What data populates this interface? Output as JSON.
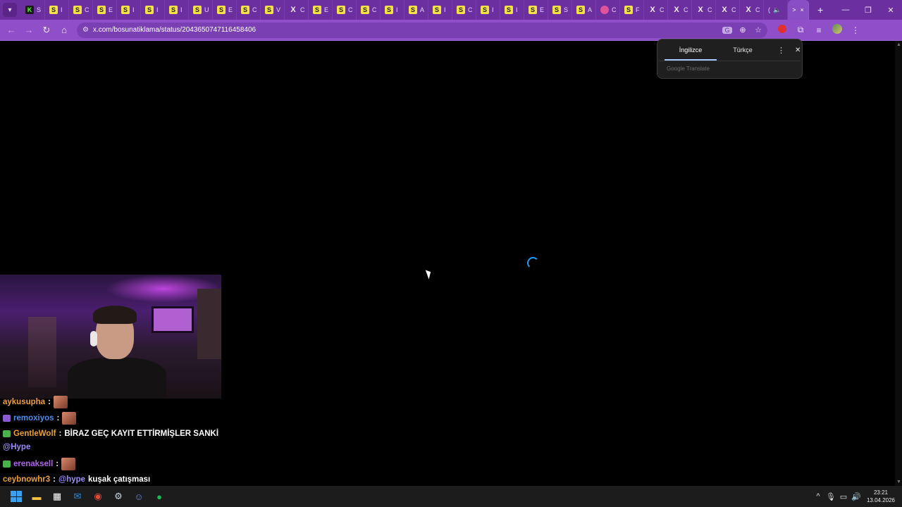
{
  "browser": {
    "tabs": [
      {
        "icon": "kick-icon",
        "glyph": "K",
        "letter": "S"
      },
      {
        "icon": "s-site-icon",
        "glyph": "S",
        "letter": "I"
      },
      {
        "icon": "s-site-icon",
        "glyph": "S",
        "letter": "C"
      },
      {
        "icon": "s-site-icon",
        "glyph": "S",
        "letter": "E"
      },
      {
        "icon": "s-site-icon",
        "glyph": "S",
        "letter": "I"
      },
      {
        "icon": "s-site-icon",
        "glyph": "S",
        "letter": "I"
      },
      {
        "icon": "s-site-icon",
        "glyph": "S",
        "letter": "I"
      },
      {
        "icon": "s-site-icon",
        "glyph": "S",
        "letter": "U"
      },
      {
        "icon": "s-site-icon",
        "glyph": "S",
        "letter": "E"
      },
      {
        "icon": "s-site-icon",
        "glyph": "S",
        "letter": "C"
      },
      {
        "icon": "s-site-icon",
        "glyph": "S",
        "letter": "V"
      },
      {
        "icon": "x-icon",
        "glyph": "X",
        "letter": "C"
      },
      {
        "icon": "s-site-icon",
        "glyph": "S",
        "letter": "E"
      },
      {
        "icon": "s-site-icon",
        "glyph": "S",
        "letter": "C"
      },
      {
        "icon": "s-site-icon",
        "glyph": "S",
        "letter": "C"
      },
      {
        "icon": "s-site-icon",
        "glyph": "S",
        "letter": "I"
      },
      {
        "icon": "s-site-icon",
        "glyph": "S",
        "letter": "A"
      },
      {
        "icon": "s-site-icon",
        "glyph": "S",
        "letter": "I"
      },
      {
        "icon": "s-site-icon",
        "glyph": "S",
        "letter": "C"
      },
      {
        "icon": "s-site-icon",
        "glyph": "S",
        "letter": "I"
      },
      {
        "icon": "s-site-icon",
        "glyph": "S",
        "letter": "I"
      },
      {
        "icon": "s-site-icon",
        "glyph": "S",
        "letter": "E"
      },
      {
        "icon": "s-site-icon",
        "glyph": "S",
        "letter": "S"
      },
      {
        "icon": "s-site-icon",
        "glyph": "S",
        "letter": "A"
      },
      {
        "icon": "pink-site-icon",
        "glyph": "",
        "letter": "C"
      },
      {
        "icon": "s-site-icon",
        "glyph": "S",
        "letter": "F"
      },
      {
        "icon": "x-icon",
        "glyph": "X",
        "letter": "C"
      },
      {
        "icon": "x-icon",
        "glyph": "X",
        "letter": "C"
      },
      {
        "icon": "x-icon",
        "glyph": "X",
        "letter": "C"
      },
      {
        "icon": "x-icon",
        "glyph": "X",
        "letter": "C"
      },
      {
        "icon": "x-icon",
        "glyph": "X",
        "letter": "C"
      }
    ],
    "audio_tab_letter": "(",
    "active_tab_letter": ">",
    "active_tab_close": "×",
    "new_tab": "+",
    "url": "x.com/bosunatiklama/status/2043650747116458406"
  },
  "translate": {
    "source_language": "İngilizce",
    "target_language": "Türkçe",
    "footer": "Google Translate"
  },
  "chat": {
    "messages": [
      {
        "user": "aykusupha",
        "color": "#f0a040",
        "separator": ":",
        "text": ""
      },
      {
        "user": "remoxiyos",
        "color": "#4a8ff0",
        "separator": ":",
        "text": ""
      },
      {
        "user": "GentleWolf",
        "color": "#f0a030",
        "separator": ":",
        "text": "BİRAZ GEÇ KAYIT ETTİRMİŞLER SANKİ"
      },
      {
        "user": "",
        "color": "#9b8cff",
        "separator": "",
        "text": "@Hype"
      },
      {
        "user": "erenaksell",
        "color": "#b060f0",
        "separator": ":",
        "text": ""
      },
      {
        "user": "ceybnowhr3",
        "color": "#f0a030",
        "separator": ":",
        "text": "kuşak çatışması",
        "mention": "@hype"
      }
    ]
  },
  "taskbar": {
    "time": "23:21",
    "date": "13.04.2026"
  }
}
